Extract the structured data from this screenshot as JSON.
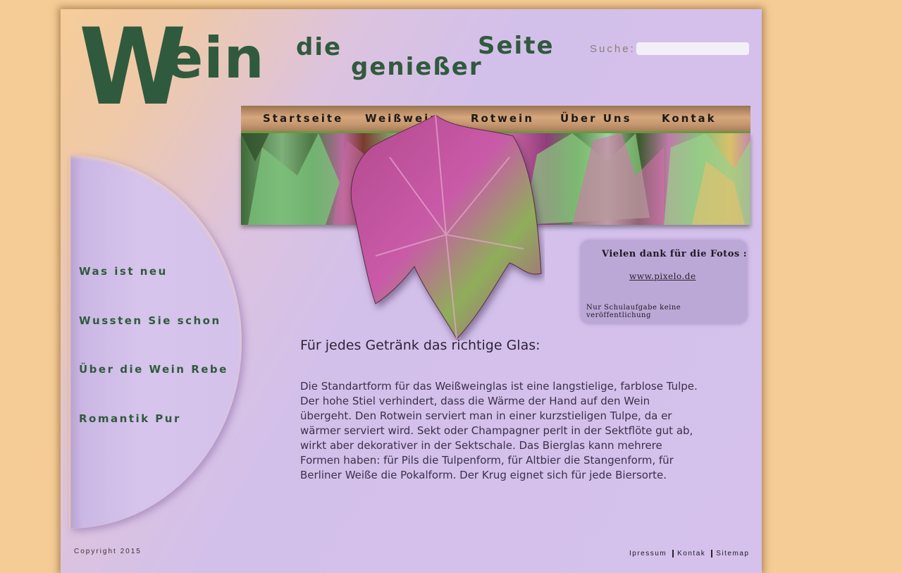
{
  "header": {
    "logo_initial": "W",
    "logo_rest": "ein",
    "tagline": [
      "die",
      "genießer",
      "Seite"
    ],
    "search_label": "Suche:",
    "search_value": ""
  },
  "nav": {
    "items": [
      "Startseite",
      "Weißwein",
      "Rotwein",
      "Über Uns",
      "Kontak"
    ]
  },
  "sidebar": {
    "items": [
      "Was ist neu",
      "Wussten Sie schon",
      "Über die Wein Rebe",
      "Romantik Pur"
    ]
  },
  "credit": {
    "title": "Vielen dank für die Fotos :",
    "link": "www.pixelo.de",
    "note": "Nur Schulaufgabe keine veröffentlichung"
  },
  "main": {
    "heading": "Für jedes Getränk das richtige Glas:",
    "paragraph": "Die Standartform für das Weißweinglas ist eine langstielige, farblose Tulpe. Der hohe Stiel verhindert, dass die Wärme der Hand auf den Wein übergeht. Den Rotwein serviert man in einer kurzstieligen Tulpe, da er wärmer serviert wird. Sekt oder Champagner perlt in der Sektflöte gut ab, wirkt aber dekorativer in der Sektschale. Das Bierglas kann mehrere Formen haben: für Pils die Tulpenform, für Altbier die Stangenform, für Berliner Weiße die Pokalform. Der Krug eignet sich für jede Biersorte."
  },
  "footer": {
    "copyright": "Copyright 2015",
    "links": [
      "Ipressum",
      "Kontak",
      "Sitemap"
    ]
  },
  "colors": {
    "background": "#f5cc95",
    "accent_green": "#305a3d",
    "page_lilac": "#d5c1ec"
  }
}
